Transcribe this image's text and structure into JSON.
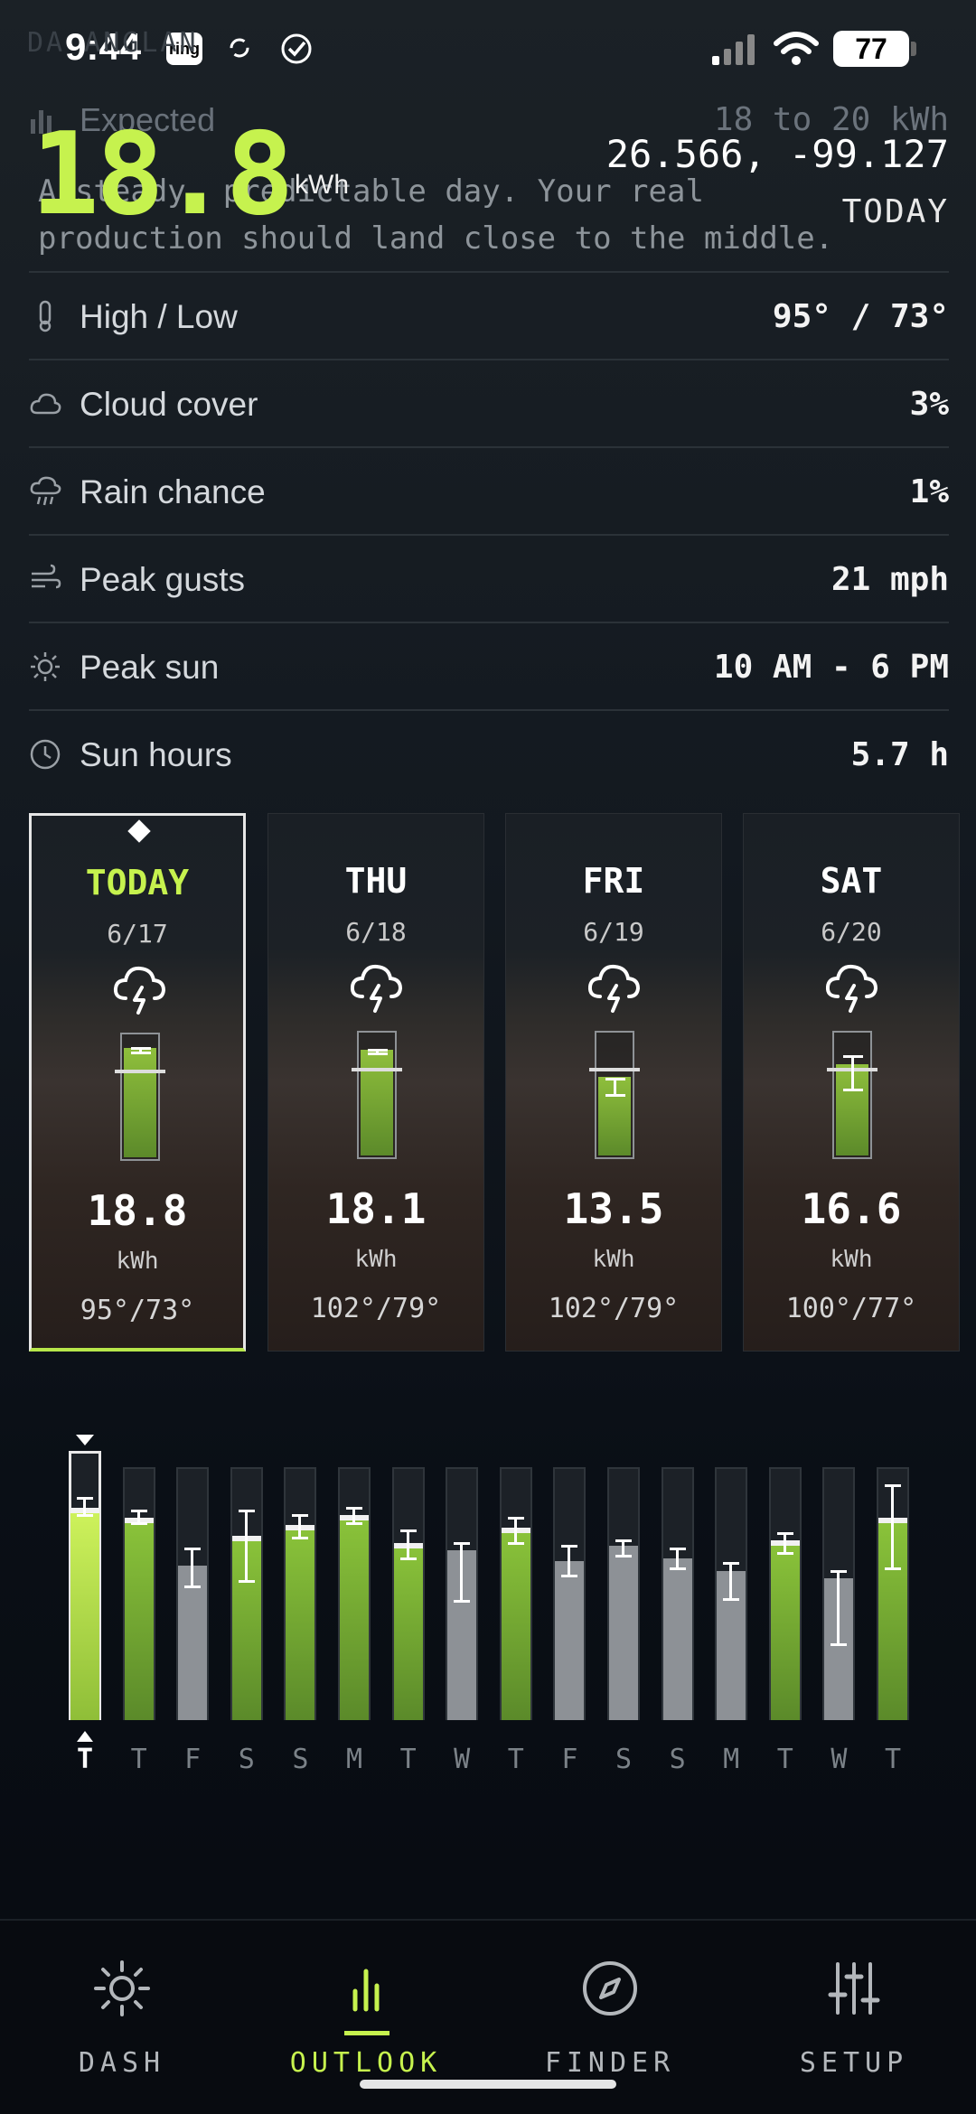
{
  "status_bar": {
    "time": "9:44",
    "ring_label": "ring",
    "battery": "77"
  },
  "header": {
    "ghost_title": "DA    ANGLAN",
    "expected_label": "Expected",
    "expected_range": "18 to 20 kWh",
    "big_value": "18.8",
    "big_unit": "kWh",
    "coordinates": "26.566, -99.127",
    "description": "A steady, predictable day. Your real production should land close to the middle.",
    "day_label": "TODAY"
  },
  "details": [
    {
      "icon": "thermometer-icon",
      "label": "High / Low",
      "value": "95° / 73°"
    },
    {
      "icon": "cloud-icon",
      "label": "Cloud cover",
      "value": "3%"
    },
    {
      "icon": "rain-icon",
      "label": "Rain chance",
      "value": "1%"
    },
    {
      "icon": "wind-icon",
      "label": "Peak gusts",
      "value": "21 mph"
    },
    {
      "icon": "sun-icon",
      "label": "Peak sun",
      "value": "10 AM - 6 PM"
    },
    {
      "icon": "clock-icon",
      "label": "Sun hours",
      "value": "5.7 h"
    }
  ],
  "cards": [
    {
      "day": "TODAY",
      "date": "6/17",
      "kwh": "18.8",
      "unit": "kWh",
      "temps": "95°/73°",
      "fill": 0.88,
      "low": 0.86,
      "high": 0.9,
      "mark": 0.72,
      "active": true,
      "icon": "thunderstorm-icon"
    },
    {
      "day": "THU",
      "date": "6/18",
      "kwh": "18.1",
      "unit": "kWh",
      "temps": "102°/79°",
      "fill": 0.85,
      "low": 0.84,
      "high": 0.87,
      "mark": 0.72,
      "active": false,
      "icon": "thunderstorm-icon"
    },
    {
      "day": "FRI",
      "date": "6/19",
      "kwh": "13.5",
      "unit": "kWh",
      "temps": "102°/79°",
      "fill": 0.63,
      "low": 0.51,
      "high": 0.64,
      "mark": 0.72,
      "active": false,
      "icon": "thunderstorm-icon"
    },
    {
      "day": "SAT",
      "date": "6/20",
      "kwh": "16.6",
      "unit": "kWh",
      "temps": "100°/77°",
      "fill": 0.73,
      "low": 0.55,
      "high": 0.82,
      "mark": 0.72,
      "active": false,
      "icon": "thunderstorm-icon"
    }
  ],
  "forecast_bars": [
    {
      "label": "T",
      "color": "green",
      "value": 0.84,
      "low": 0.81,
      "high": 0.88,
      "selected": true
    },
    {
      "label": "T",
      "color": "green",
      "value": 0.8,
      "low": 0.78,
      "high": 0.83,
      "selected": false
    },
    {
      "label": "F",
      "color": "gray",
      "value": 0.61,
      "low": 0.53,
      "high": 0.68,
      "selected": false
    },
    {
      "label": "S",
      "color": "green",
      "value": 0.73,
      "low": 0.55,
      "high": 0.83,
      "selected": false
    },
    {
      "label": "S",
      "color": "green",
      "value": 0.77,
      "low": 0.72,
      "high": 0.81,
      "selected": false
    },
    {
      "label": "M",
      "color": "green",
      "value": 0.81,
      "low": 0.78,
      "high": 0.84,
      "selected": false
    },
    {
      "label": "T",
      "color": "green",
      "value": 0.7,
      "low": 0.64,
      "high": 0.75,
      "selected": false
    },
    {
      "label": "W",
      "color": "gray",
      "value": 0.67,
      "low": 0.47,
      "high": 0.7,
      "selected": false
    },
    {
      "label": "T",
      "color": "green",
      "value": 0.76,
      "low": 0.7,
      "high": 0.8,
      "selected": false
    },
    {
      "label": "F",
      "color": "gray",
      "value": 0.63,
      "low": 0.57,
      "high": 0.69,
      "selected": false
    },
    {
      "label": "S",
      "color": "gray",
      "value": 0.69,
      "low": 0.65,
      "high": 0.71,
      "selected": false
    },
    {
      "label": "S",
      "color": "gray",
      "value": 0.64,
      "low": 0.6,
      "high": 0.68,
      "selected": false
    },
    {
      "label": "M",
      "color": "gray",
      "value": 0.59,
      "low": 0.48,
      "high": 0.62,
      "selected": false
    },
    {
      "label": "T",
      "color": "green",
      "value": 0.71,
      "low": 0.66,
      "high": 0.74,
      "selected": false
    },
    {
      "label": "W",
      "color": "gray",
      "value": 0.56,
      "low": 0.3,
      "high": 0.59,
      "selected": false
    },
    {
      "label": "T",
      "color": "green",
      "value": 0.8,
      "low": 0.6,
      "high": 0.93,
      "selected": false
    }
  ],
  "nav": [
    {
      "label": "DASH",
      "icon": "sun-icon",
      "active": false
    },
    {
      "label": "OUTLOOK",
      "icon": "bar-chart-icon",
      "active": true
    },
    {
      "label": "FINDER",
      "icon": "compass-icon",
      "active": false
    },
    {
      "label": "SETUP",
      "icon": "sliders-icon",
      "active": false
    }
  ],
  "colors": {
    "accent": "#c6f24e",
    "bar_green": "#7cb033",
    "bar_gray": "#8d9196"
  }
}
